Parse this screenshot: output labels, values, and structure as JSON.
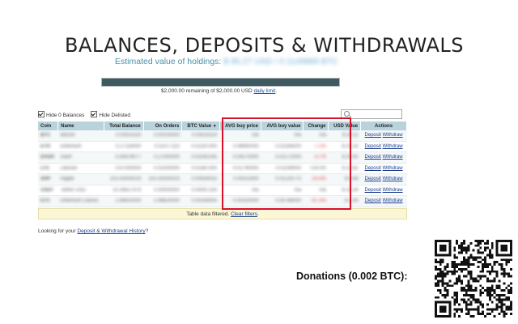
{
  "page": {
    "title": "BALANCES, DEPOSITS & WITHDRAWALS",
    "estimated_label": "Estimated value of holdings:",
    "estimated_value": "$ 95.27 USD / 0.1149889 BTC",
    "limit_progress_fraction": 0.0,
    "limit_text": "$2,000.00 remaining of $2,000.00 USD ",
    "limit_link": "daily limit",
    "limit_tail": ".",
    "hide_zero_label": "Hide 0 Balances",
    "hide_delisted_label": "Hide Delisted",
    "hide_zero_checked": true,
    "hide_delisted_checked": true,
    "search_placeholder": "",
    "filter_text": "Table data filtered. ",
    "filter_link": "Clear filters",
    "filter_tail": ".",
    "looking_text": "Looking for your ",
    "looking_link": "Deposit & Withdrawal History",
    "looking_tail": "?",
    "donations_label": "Donations (0.002 BTC):"
  },
  "table": {
    "headers": {
      "coin": "Coin",
      "name": "Name",
      "total": "Total Balance",
      "orders": "On Orders",
      "btc": "BTC Value",
      "btc_sort": "▼",
      "avg_price": "AVG buy price",
      "avg_value": "AVG buy value",
      "change": "Change",
      "usd": "USD Value",
      "actions": "Actions"
    },
    "deposit_label": "Deposit",
    "withdraw_label": "Withdraw",
    "rows": [
      {
        "coin": "BTC",
        "name": "Bitcoin",
        "total": "0.03023114",
        "orders": "0.00100000",
        "btc": "0.03023114",
        "avg_price": "n/a",
        "avg_value": "n/a",
        "change": "n/a",
        "usd": "$ 28.11"
      },
      {
        "coin": "ETH",
        "name": "Ethereum",
        "total": "0.27118000",
        "orders": "0.02377110",
        "btc": "0.02187000",
        "avg_price": "0.08690000",
        "avg_value": "0.02356000",
        "change": "-7.2%",
        "usd": "$ 20.33"
      },
      {
        "coin": "DASH",
        "name": "Dash",
        "total": "0.50878077",
        "orders": "0.27000000",
        "btc": "0.02092145",
        "avg_price": "0.04270000",
        "avg_value": "0.02172000",
        "change": "-3.7%",
        "usd": "$ 19.45"
      },
      {
        "coin": "LTC",
        "name": "Litecoin",
        "total": "0.67000000",
        "orders": "0.01000000",
        "btc": "0.01487000",
        "avg_price": "0.01790000",
        "avg_value": "0.01199000",
        "change": "+24.0%",
        "usd": "$ 13.82"
      },
      {
        "coin": "XRP",
        "name": "Ripple",
        "total": "102.50000014",
        "orders": "102.50000014",
        "btc": "0.00934032",
        "avg_price": "0.00011900",
        "avg_value": "0.01219770",
        "change": "-23.4%",
        "usd": "$ 8.68"
      },
      {
        "coin": "USDT",
        "name": "Tether USD",
        "total": "10.34817974",
        "orders": "0.00000000",
        "btc": "0.00097230",
        "avg_price": "n/a",
        "avg_value": "n/a",
        "change": "n/a",
        "usd": "$ 10.34"
      },
      {
        "coin": "ETC",
        "name": "Ethereum Classic",
        "total": "2.46620000",
        "orders": "2.46620000",
        "btc": "0.00258000",
        "avg_price": "0.00320000",
        "avg_value": "0.00789000",
        "change": "-67.3%",
        "usd": "$ 2.40"
      }
    ]
  },
  "colors": {
    "accent_bar": "#3f5961",
    "header_bg": "#b8d3dc",
    "highlight_box": "#d8102a",
    "link": "#1a3d8f"
  },
  "icons": {
    "search": "magnifier-icon",
    "qr": "qr-code"
  }
}
